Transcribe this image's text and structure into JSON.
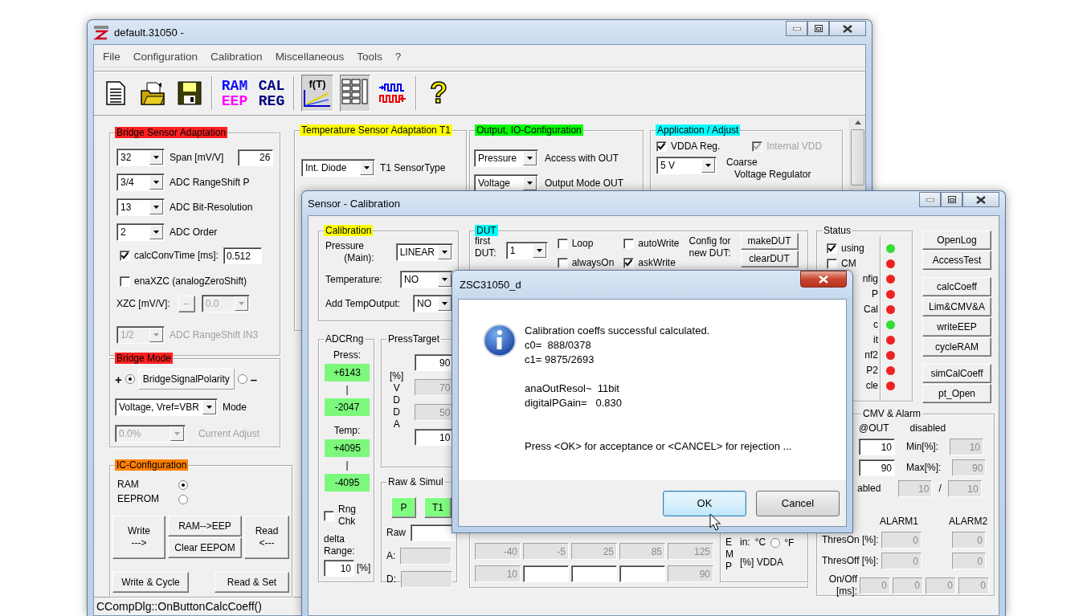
{
  "main_window": {
    "title": "default.31050 -",
    "menu": [
      "File",
      "Configuration",
      "Calibration",
      "Miscellaneous",
      "Tools",
      "?"
    ],
    "toolbar": [
      {
        "kind": "document",
        "pressed": false
      },
      {
        "kind": "open",
        "pressed": false
      },
      {
        "kind": "save",
        "pressed": false
      },
      {
        "kind": "separator"
      },
      {
        "kind": "text",
        "top": "RAM",
        "bottom": "EEP",
        "pressed": false
      },
      {
        "kind": "text",
        "top": "CAL",
        "bottom": "REG",
        "pressed": false
      },
      {
        "kind": "separator"
      },
      {
        "kind": "function",
        "label": "f(T)",
        "pressed": true
      },
      {
        "kind": "table",
        "pressed": true
      },
      {
        "kind": "signal",
        "pressed": false
      },
      {
        "kind": "separator"
      },
      {
        "kind": "help",
        "label": "?",
        "pressed": false
      }
    ],
    "groups": [
      {
        "title": "Bridge Sensor Adaptation",
        "color": "#ff2020",
        "rows": [
          [
            {
              "kind": "combo",
              "value": "32",
              "disabled": false
            },
            {
              "kind": "label",
              "text": "Span [mV/V]"
            },
            {
              "kind": "field",
              "value": "26",
              "disabled": false
            }
          ],
          [
            {
              "kind": "combo",
              "value": "3/4",
              "disabled": false
            },
            {
              "kind": "label",
              "text": "ADC RangeShift P"
            }
          ],
          [
            {
              "kind": "combo",
              "value": "13",
              "disabled": false
            },
            {
              "kind": "label",
              "text": "ADC Bit-Resolution"
            }
          ],
          [
            {
              "kind": "combo",
              "value": "2",
              "disabled": false
            },
            {
              "kind": "label",
              "text": "ADC Order"
            }
          ],
          [
            {
              "kind": "check",
              "label": "calcConvTime [ms]:",
              "checked": true
            },
            {
              "kind": "field",
              "value": "0.512",
              "disabled": false
            }
          ],
          [
            {
              "kind": "check",
              "label": "enaXZC (analogZeroShift)",
              "checked": false
            }
          ],
          [
            {
              "kind": "row",
              "items": [
                {
                  "kind": "label",
                  "text": "XZC [mV/V]:"
                },
                {
                  "kind": "button",
                  "label": "–",
                  "disabled": true
                },
                {
                  "kind": "combo",
                  "value": "0.0",
                  "disabled": true
                }
              ]
            }
          ],
          [
            {
              "kind": "combo",
              "value": "1/2",
              "disabled": true
            },
            {
              "kind": "label",
              "text": "ADC RangeShift IN3",
              "disabled": true
            }
          ]
        ]
      },
      {
        "title": "Bridge Mode",
        "color": "#ff2020",
        "rows": [
          [
            {
              "kind": "label",
              "text": "+"
            },
            {
              "kind": "radio",
              "selected": true
            },
            {
              "kind": "static",
              "text": "BridgeSignalPolarity"
            },
            {
              "kind": "radio",
              "selected": false
            },
            {
              "kind": "label",
              "text": "–"
            }
          ],
          [
            {
              "kind": "combo",
              "value": "Voltage, Vref=VBR",
              "disabled": false
            },
            {
              "kind": "label",
              "text": "Mode"
            }
          ],
          [
            {
              "kind": "combo",
              "value": "0.0%",
              "disabled": true
            },
            {
              "kind": "label",
              "text": "Current Adjust",
              "disabled": true
            }
          ]
        ]
      },
      {
        "title": "IC-Configuration",
        "color": "#ff8000",
        "rows": [
          [
            {
              "kind": "label",
              "text": "RAM"
            },
            {
              "kind": "radio",
              "selected": true
            }
          ],
          [
            {
              "kind": "label",
              "text": "EEPROM"
            },
            {
              "kind": "radio",
              "selected": false
            }
          ],
          [
            {
              "kind": "button",
              "label": "Write\n--->"
            },
            {
              "kind": "column",
              "items": [
                {
                  "kind": "button",
                  "label": "RAM-->EEP"
                },
                {
                  "kind": "button",
                  "label": "Clear EEPOM"
                }
              ]
            },
            {
              "kind": "button",
              "label": "Read\n<---"
            }
          ],
          [
            {
              "kind": "button",
              "label": "Write & Cycle"
            },
            {
              "kind": "button",
              "label": "Read & Set"
            }
          ]
        ]
      },
      {
        "title": "Temperature Sensor Adaptation T1",
        "color": "#ffff00",
        "rows": [
          [
            {
              "kind": "combo",
              "value": "Int. Diode",
              "disabled": false
            },
            {
              "kind": "label",
              "text": "T1 SensorType"
            }
          ]
        ]
      },
      {
        "title": "Output, IO-Configuration",
        "color": "#00ff00",
        "rows": [
          [
            {
              "kind": "combo",
              "value": "Pressure",
              "disabled": false
            },
            {
              "kind": "label",
              "text": "Access with OUT"
            }
          ],
          [
            {
              "kind": "combo",
              "value": "Voltage",
              "disabled": false
            },
            {
              "kind": "label",
              "text": "Output Mode OUT"
            }
          ]
        ]
      },
      {
        "title": "Application / Adjust",
        "color": "#00ffff",
        "rows": [
          [
            {
              "kind": "check",
              "label": "VDDA Reg.",
              "checked": true,
              "disabled": false
            },
            {
              "kind": "check",
              "label": "Internal VDD",
              "checked": true,
              "disabled": true
            }
          ],
          [
            {
              "kind": "combo",
              "value": "5 V",
              "disabled": false
            },
            {
              "kind": "label",
              "text": "Coarse\n   Voltage Regulator"
            }
          ]
        ]
      }
    ],
    "status_bar": "CCompDlg::OnButtonCalcCoeff()"
  },
  "calibration_window": {
    "title": "Sensor - Calibration",
    "groups": [
      {
        "title": "Calibration",
        "color": "#ffff00",
        "rows": [
          [
            {
              "kind": "label",
              "text": "Pressure\n       (Main):"
            },
            {
              "kind": "combo",
              "value": "LINEAR",
              "disabled": false
            }
          ],
          [
            {
              "kind": "label",
              "text": "Temperature:"
            },
            {
              "kind": "combo",
              "value": "NO",
              "disabled": false
            }
          ],
          [
            {
              "kind": "label",
              "text": "Add TempOutput:"
            },
            {
              "kind": "combo",
              "value": "NO",
              "disabled": false
            }
          ]
        ]
      },
      {
        "title": "ADCRng",
        "rows": [
          [
            {
              "kind": "label",
              "text": "Press:"
            }
          ],
          [
            {
              "kind": "reading",
              "value": "+6143"
            }
          ],
          [
            {
              "kind": "label",
              "text": "|"
            }
          ],
          [
            {
              "kind": "reading",
              "value": "-2047"
            }
          ],
          [
            {
              "kind": "label",
              "text": "Temp:"
            }
          ],
          [
            {
              "kind": "reading",
              "value": "+4095"
            }
          ],
          [
            {
              "kind": "label",
              "text": "|"
            }
          ],
          [
            {
              "kind": "reading",
              "value": "-4095"
            }
          ],
          [
            {
              "kind": "check",
              "label": "Rng\nChk",
              "checked": false
            }
          ],
          [
            {
              "kind": "label",
              "text": "delta\nRange:"
            }
          ],
          [
            {
              "kind": "field",
              "value": "10",
              "disabled": false
            },
            {
              "kind": "label",
              "text": "[%]"
            }
          ]
        ]
      },
      {
        "title": "PressTarget",
        "rows": [
          [
            {
              "kind": "label",
              "text": "[%]\nV\nD\nD\nA"
            },
            {
              "kind": "column",
              "items": [
                {
                  "kind": "field",
                  "value": "90",
                  "disabled": false
                },
                {
                  "kind": "field",
                  "value": "70",
                  "disabled": true
                },
                {
                  "kind": "field",
                  "value": "50",
                  "disabled": true
                },
                {
                  "kind": "field",
                  "value": "10",
                  "disabled": false
                }
              ]
            }
          ]
        ]
      },
      {
        "title": "Raw & Simul",
        "rows": [
          [
            {
              "kind": "button",
              "label": "P",
              "on": true
            },
            {
              "kind": "button",
              "label": "T1",
              "on": true
            }
          ],
          [
            {
              "kind": "label",
              "text": "Raw"
            },
            {
              "kind": "field",
              "disabled": false
            }
          ],
          [
            {
              "kind": "label",
              "text": "A:"
            },
            {
              "kind": "field",
              "disabled": true
            }
          ],
          [
            {
              "kind": "label",
              "text": "D:"
            },
            {
              "kind": "field",
              "disabled": true
            }
          ]
        ]
      },
      {
        "title": "DUT",
        "color": "#00ffff",
        "rows": [
          [
            {
              "kind": "row",
              "items": [
                {
                  "kind": "label",
                  "text": "first\nDUT:"
                },
                {
                  "kind": "combo",
                  "value": "1",
                  "disabled": false
                },
                {
                  "kind": "column",
                  "items": [
                    {
                      "kind": "check",
                      "label": "Loop",
                      "checked": false
                    },
                    {
                      "kind": "check",
                      "label": "alwaysOn",
                      "checked": false
                    }
                  ]
                },
                {
                  "kind": "column",
                  "items": [
                    {
                      "kind": "check",
                      "label": "autoWrite",
                      "checked": false
                    },
                    {
                      "kind": "check",
                      "label": "askWrite",
                      "checked": true
                    }
                  ]
                },
                {
                  "kind": "label",
                  "text": "Config for\nnew DUT:"
                },
                {
                  "kind": "column",
                  "items": [
                    {
                      "kind": "button",
                      "label": "makeDUT"
                    },
                    {
                      "kind": "button",
                      "label": "clearDUT"
                    }
                  ]
                }
              ]
            }
          ],
          [
            {
              "kind": "column",
              "items": [
                {
                  "kind": "row",
                  "items": [
                    {
                      "kind": "field",
                      "value": "-40",
                      "disabled": true
                    },
                    {
                      "kind": "field",
                      "value": "-5",
                      "disabled": true
                    },
                    {
                      "kind": "field",
                      "value": "25",
                      "disabled": true
                    },
                    {
                      "kind": "field",
                      "value": "85",
                      "disabled": true
                    },
                    {
                      "kind": "field",
                      "value": "125",
                      "disabled": true
                    }
                  ]
                },
                {
                  "kind": "row",
                  "items": [
                    {
                      "kind": "field",
                      "value": "10",
                      "disabled": true
                    },
                    {
                      "kind": "field",
                      "disabled": false
                    },
                    {
                      "kind": "field",
                      "disabled": false
                    },
                    {
                      "kind": "field",
                      "disabled": false
                    },
                    {
                      "kind": "field",
                      "value": "90",
                      "disabled": true
                    }
                  ]
                }
              ]
            },
            {
              "kind": "box",
              "items": [
                {
                  "kind": "label",
                  "text": "E\nM\nP"
                },
                {
                  "kind": "column",
                  "items": [
                    {
                      "kind": "row",
                      "items": [
                        {
                          "kind": "label",
                          "text": "in:"
                        },
                        {
                          "kind": "label",
                          "text": "°C"
                        },
                        {
                          "kind": "radio",
                          "label": "°F",
                          "selected": false
                        }
                      ]
                    },
                    {
                      "kind": "label",
                      "text": "[%] VDDA"
                    }
                  ]
                }
              ]
            }
          ]
        ]
      },
      {
        "title": "Status",
        "rows": [
          [
            {
              "kind": "check",
              "label": "using",
              "checked": true
            },
            {
              "kind": "led",
              "color": "#33dd33"
            }
          ],
          [
            {
              "kind": "check",
              "label": "CM",
              "checked": false
            },
            {
              "kind": "led",
              "color": "#ee2222"
            }
          ],
          [
            {
              "kind": "label",
              "text": "nfig"
            },
            {
              "kind": "led",
              "color": "#ee2222"
            }
          ],
          [
            {
              "kind": "label",
              "text": "P"
            },
            {
              "kind": "led",
              "color": "#ee2222"
            }
          ],
          [
            {
              "kind": "label",
              "text": "Cal"
            },
            {
              "kind": "led",
              "color": "#ee2222"
            }
          ],
          [
            {
              "kind": "label",
              "text": "c"
            },
            {
              "kind": "led",
              "color": "#33dd33"
            }
          ],
          [
            {
              "kind": "label",
              "text": "it"
            },
            {
              "kind": "led",
              "color": "#ee2222"
            }
          ],
          [
            {
              "kind": "label",
              "text": "nf2"
            },
            {
              "kind": "led",
              "color": "#ee2222"
            }
          ],
          [
            {
              "kind": "label",
              "text": "P2"
            },
            {
              "kind": "led",
              "color": "#ee2222"
            }
          ],
          [
            {
              "kind": "label",
              "text": "cle"
            },
            {
              "kind": "led",
              "color": "#ee2222"
            }
          ]
        ]
      },
      {
        "title": "CMV & Alarm",
        "rows": [
          [
            {
              "kind": "label",
              "text": "@OUT"
            },
            {
              "kind": "label",
              "text": "disabled"
            }
          ],
          [
            {
              "kind": "field",
              "value": "10",
              "disabled": false
            },
            {
              "kind": "label",
              "text": "Min[%]:"
            },
            {
              "kind": "field",
              "value": "10",
              "disabled": true
            }
          ],
          [
            {
              "kind": "field",
              "value": "90",
              "disabled": false
            },
            {
              "kind": "label",
              "text": "Max[%]:"
            },
            {
              "kind": "field",
              "value": "90",
              "disabled": true
            }
          ],
          [
            {
              "kind": "label",
              "text": "abled"
            },
            {
              "kind": "field",
              "value": "10",
              "disabled": true
            },
            {
              "kind": "label",
              "text": "/"
            },
            {
              "kind": "field",
              "value": "10",
              "disabled": true
            }
          ],
          [
            {
              "kind": "row",
              "items": [
                {
                  "kind": "label",
                  "text": "ALARM1"
                },
                {
                  "kind": "label",
                  "text": "ALARM2"
                }
              ]
            }
          ],
          [
            {
              "kind": "label",
              "text": "ThresOn [%]:"
            },
            {
              "kind": "field",
              "value": "0",
              "disabled": true
            },
            {
              "kind": "field",
              "value": "0",
              "disabled": true
            }
          ],
          [
            {
              "kind": "label",
              "text": "ThresOff [%]:"
            },
            {
              "kind": "field",
              "value": "0",
              "disabled": true
            },
            {
              "kind": "field",
              "value": "0",
              "disabled": true
            }
          ],
          [
            {
              "kind": "label",
              "text": "On/Off\n[ms]:"
            },
            {
              "kind": "row",
              "items": [
                {
                  "kind": "field",
                  "value": "0",
                  "disabled": true
                },
                {
                  "kind": "field",
                  "value": "0",
                  "disabled": true
                },
                {
                  "kind": "field",
                  "value": "0",
                  "disabled": true
                },
                {
                  "kind": "field",
                  "value": "0",
                  "disabled": true
                }
              ]
            }
          ]
        ]
      }
    ],
    "button_groups": [
      [
        "OpenLog",
        "AccessTest"
      ],
      [
        "calcCoeff",
        "Lim&CMV&A",
        "writeEEP",
        "cycleRAM"
      ],
      [
        "simCalCoeff",
        "pt_Open"
      ]
    ]
  },
  "message_box": {
    "title": "ZSC31050_d",
    "paragraphs": [
      [
        "Calibration coeffs successful calculated.",
        "c0=  888/0378",
        "c1= 9875/2693"
      ],
      [
        "anaOutResol~  11bit",
        "digitalPGain=   0.830"
      ],
      [
        "Press <OK> for acceptance or <CANCEL> for rejection ..."
      ]
    ],
    "buttons": [
      {
        "label": "OK",
        "default": true
      },
      {
        "label": "Cancel",
        "default": false
      }
    ]
  }
}
